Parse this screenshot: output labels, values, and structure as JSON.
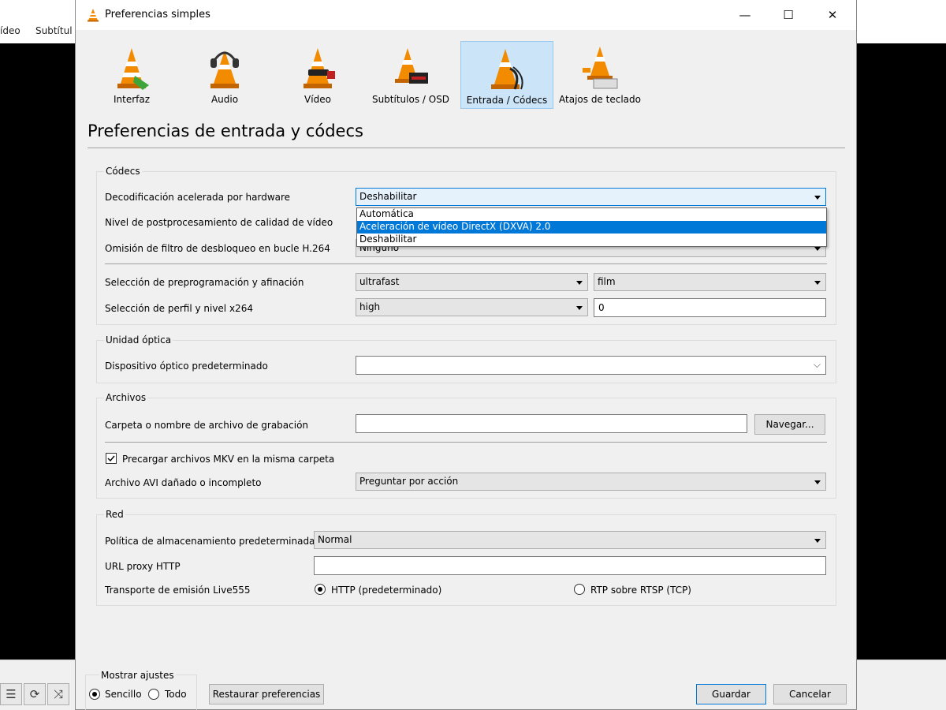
{
  "background": {
    "menu": [
      "ídeo",
      "Subtítul"
    ]
  },
  "window": {
    "title": "Preferencias simples",
    "minimize": "—",
    "maximize": "☐",
    "close": "✕"
  },
  "tabs": [
    {
      "label": "Interfaz",
      "icon": "interface-cone-icon",
      "active": false
    },
    {
      "label": "Audio",
      "icon": "audio-headphones-cone-icon",
      "active": false
    },
    {
      "label": "Vídeo",
      "icon": "video-glasses-cone-icon",
      "active": false
    },
    {
      "label": "Subtítulos / OSD",
      "icon": "subtitles-cone-icon",
      "active": false
    },
    {
      "label": "Entrada / Códecs",
      "icon": "input-codecs-cone-icon",
      "active": true
    },
    {
      "label": "Atajos de teclado",
      "icon": "hotkeys-cone-icon",
      "active": false
    }
  ],
  "page_title": "Preferencias de entrada y códecs",
  "codecs": {
    "group_title": "Códecs",
    "hw_decoding_label": "Decodificación acelerada por hardware",
    "hw_decoding_value": "Deshabilitar",
    "hw_decoding_options": [
      "Automática",
      "Aceleración de vídeo DirectX (DXVA) 2.0",
      "Deshabilitar"
    ],
    "hw_decoding_highlighted": "Aceleración de vídeo DirectX (DXVA) 2.0",
    "postproc_label": "Nivel de postprocesamiento de calidad de vídeo",
    "h264_skip_label": "Omisión de filtro de desbloqueo en bucle H.264",
    "h264_skip_value": "Ninguno",
    "preset_label": "Selección de preprogramación y afinación",
    "preset_value": "ultrafast",
    "tune_value": "film",
    "profile_label": "Selección de perfil y nivel x264",
    "profile_value": "high",
    "level_value": "0"
  },
  "optical": {
    "group_title": "Unidad óptica",
    "device_label": "Dispositivo óptico predeterminado",
    "device_value": ""
  },
  "files": {
    "group_title": "Archivos",
    "record_label": "Carpeta o nombre de archivo de grabación",
    "record_value": "",
    "browse_button": "Navegar...",
    "preload_mkv_label": "Precargar archivos MKV en la misma carpeta",
    "preload_mkv_checked": true,
    "avi_label": "Archivo AVI dañado o incompleto",
    "avi_value": "Preguntar por acción"
  },
  "network": {
    "group_title": "Red",
    "caching_label": "Política de almacenamiento predeterminada",
    "caching_value": "Normal",
    "proxy_label": "URL proxy HTTP",
    "proxy_value": "",
    "live555_label": "Transporte de emisión Live555",
    "http_option": "HTTP (predeterminado)",
    "rtp_option": "RTP sobre RTSP (TCP)",
    "selected": "HTTP (predeterminado)"
  },
  "footer": {
    "show_settings_title": "Mostrar ajustes",
    "simple_option": "Sencillo",
    "all_option": "Todo",
    "selected": "Sencillo",
    "reset_button": "Restaurar preferencias",
    "save_button": "Guardar",
    "cancel_button": "Cancelar"
  },
  "colors": {
    "accent": "#0078d7",
    "tab_active_bg": "#cce4f7",
    "cone_orange": "#f28b00"
  }
}
